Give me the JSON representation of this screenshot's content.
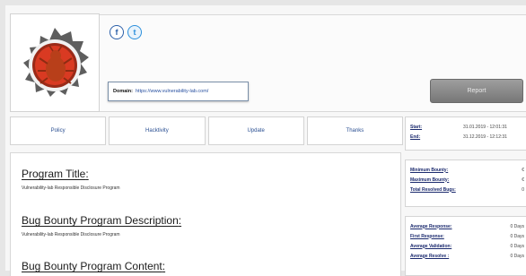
{
  "header": {
    "social": [
      {
        "icon": "facebook-icon",
        "glyph": "f"
      },
      {
        "icon": "twitter-icon",
        "glyph": "t"
      }
    ],
    "domain_label": "Domain:",
    "domain_value": "https://www.vulnerability-lab.com/",
    "report_label": "Report"
  },
  "tabs": [
    "Policy",
    "Hacktivity",
    "Update",
    "Thanks"
  ],
  "sections": [
    {
      "title": "Program Title",
      "text": "Vulnerability-lab Responsible Disclosure Program"
    },
    {
      "title": "Bug Bounty Program Description",
      "text": "Vulnerability-lab Responsible Disclosure Program"
    },
    {
      "title": "Bug Bounty Program Content",
      "text": ""
    }
  ],
  "dates": [
    {
      "key": "Start:",
      "value": "31.01.2019 - 12:01:31"
    },
    {
      "key": "End:",
      "value": "31.12.2019 - 12:12:31"
    }
  ],
  "bounty": [
    {
      "key": "Minimum Bounty:",
      "value": "€"
    },
    {
      "key": "Maximum Bounty:",
      "value": "€"
    },
    {
      "key": "Total Resolved Bugs:",
      "value": "0"
    }
  ],
  "response": [
    {
      "key": "Average Response:",
      "value": "0 Days"
    },
    {
      "key": "First Response:",
      "value": "0 Days"
    },
    {
      "key": "Average Validation:",
      "value": "0 Days"
    },
    {
      "key": "Average Resolve :",
      "value": "0 Days"
    }
  ],
  "colors": {
    "accent": "#2a4f92",
    "logo_red": "#d93a22",
    "logo_gear": "#666666"
  }
}
